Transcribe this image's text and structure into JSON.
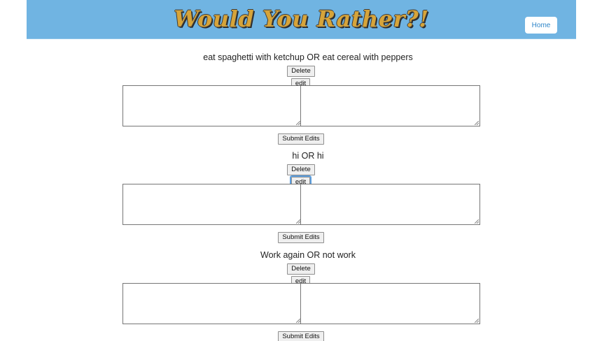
{
  "app": {
    "title": "Would You Rather?!",
    "home_label": "Home"
  },
  "questions": [
    {
      "text": "eat spaghetti with ketchup OR eat cereal with peppers",
      "delete_label": "Delete",
      "edit_label": "edit",
      "submit_label": "Submit Edits"
    },
    {
      "text": "hi OR hi",
      "delete_label": "Delete",
      "edit_label": "edit",
      "submit_label": "Submit Edits"
    },
    {
      "text": "Work again OR not work",
      "delete_label": "Delete",
      "edit_label": "edit",
      "submit_label": "Submit Edits"
    }
  ],
  "colors": {
    "header_bg": "#70b4e2",
    "title_fill": "#d6a43a",
    "home_text": "#2f86c9",
    "focus_ring": "#5b9fe0"
  }
}
